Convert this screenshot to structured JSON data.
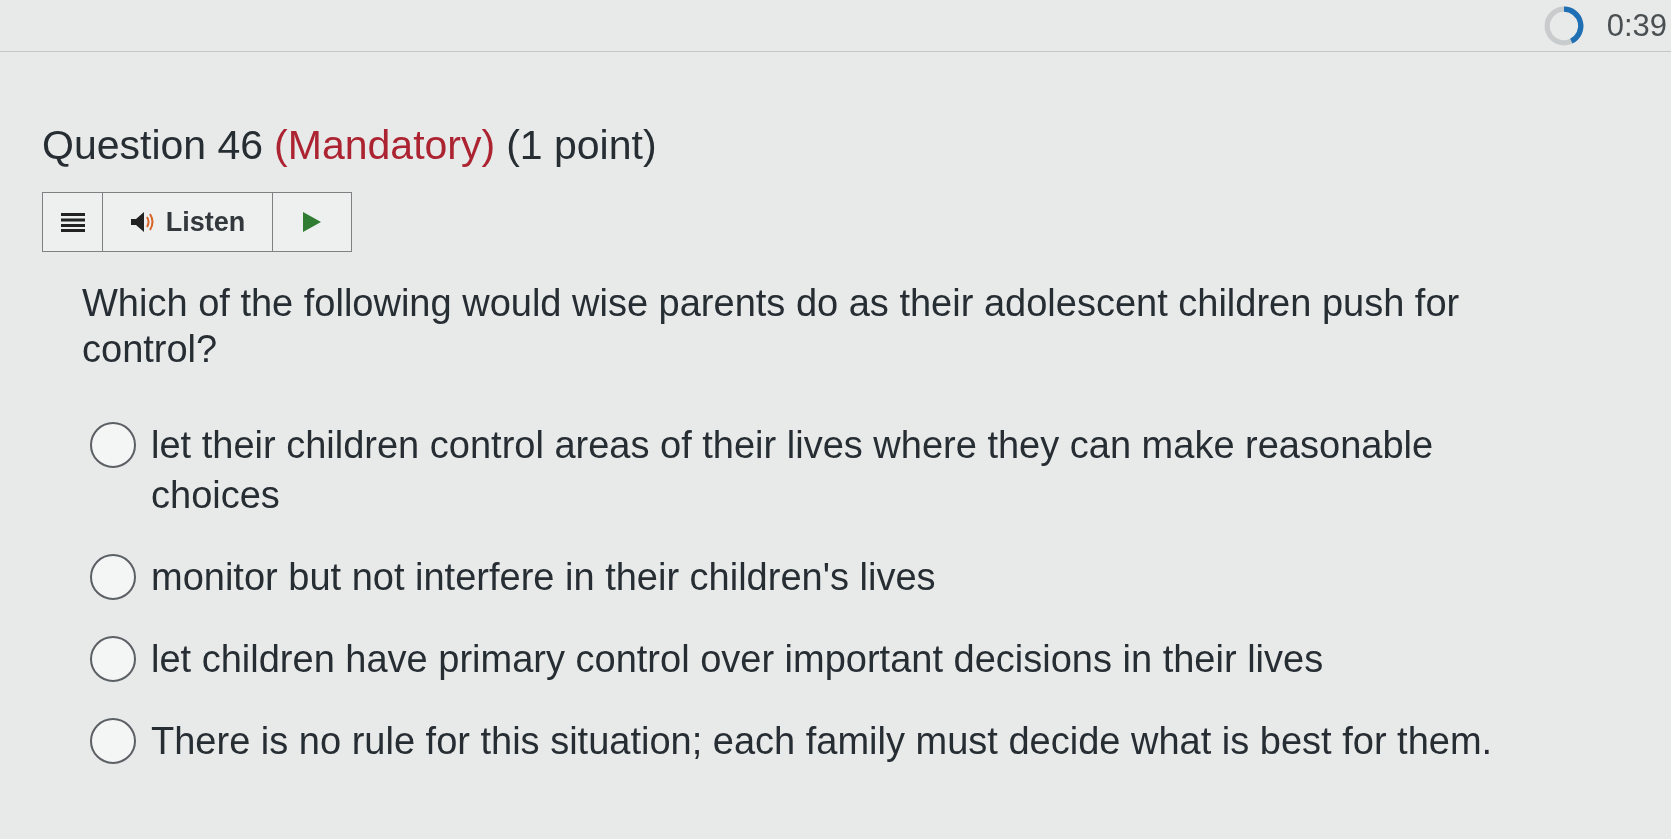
{
  "timer": {
    "text": "0:39"
  },
  "question": {
    "title": "Question 46",
    "mandatory": "(Mandatory)",
    "points": "(1 point)"
  },
  "toolbar": {
    "listen": "Listen"
  },
  "prompt": "Which of the following would wise parents do as their adolescent children push for control?",
  "options": [
    {
      "text": "let their children control areas of their lives where they can make reasonable choices",
      "selected": false
    },
    {
      "text": "monitor but not interfere in their children's lives",
      "selected": false
    },
    {
      "text": "let children have primary control over important decisions in their lives",
      "selected": false
    },
    {
      "text": "There is no rule for this situation; each family must decide what is best for them.",
      "selected": false
    }
  ]
}
